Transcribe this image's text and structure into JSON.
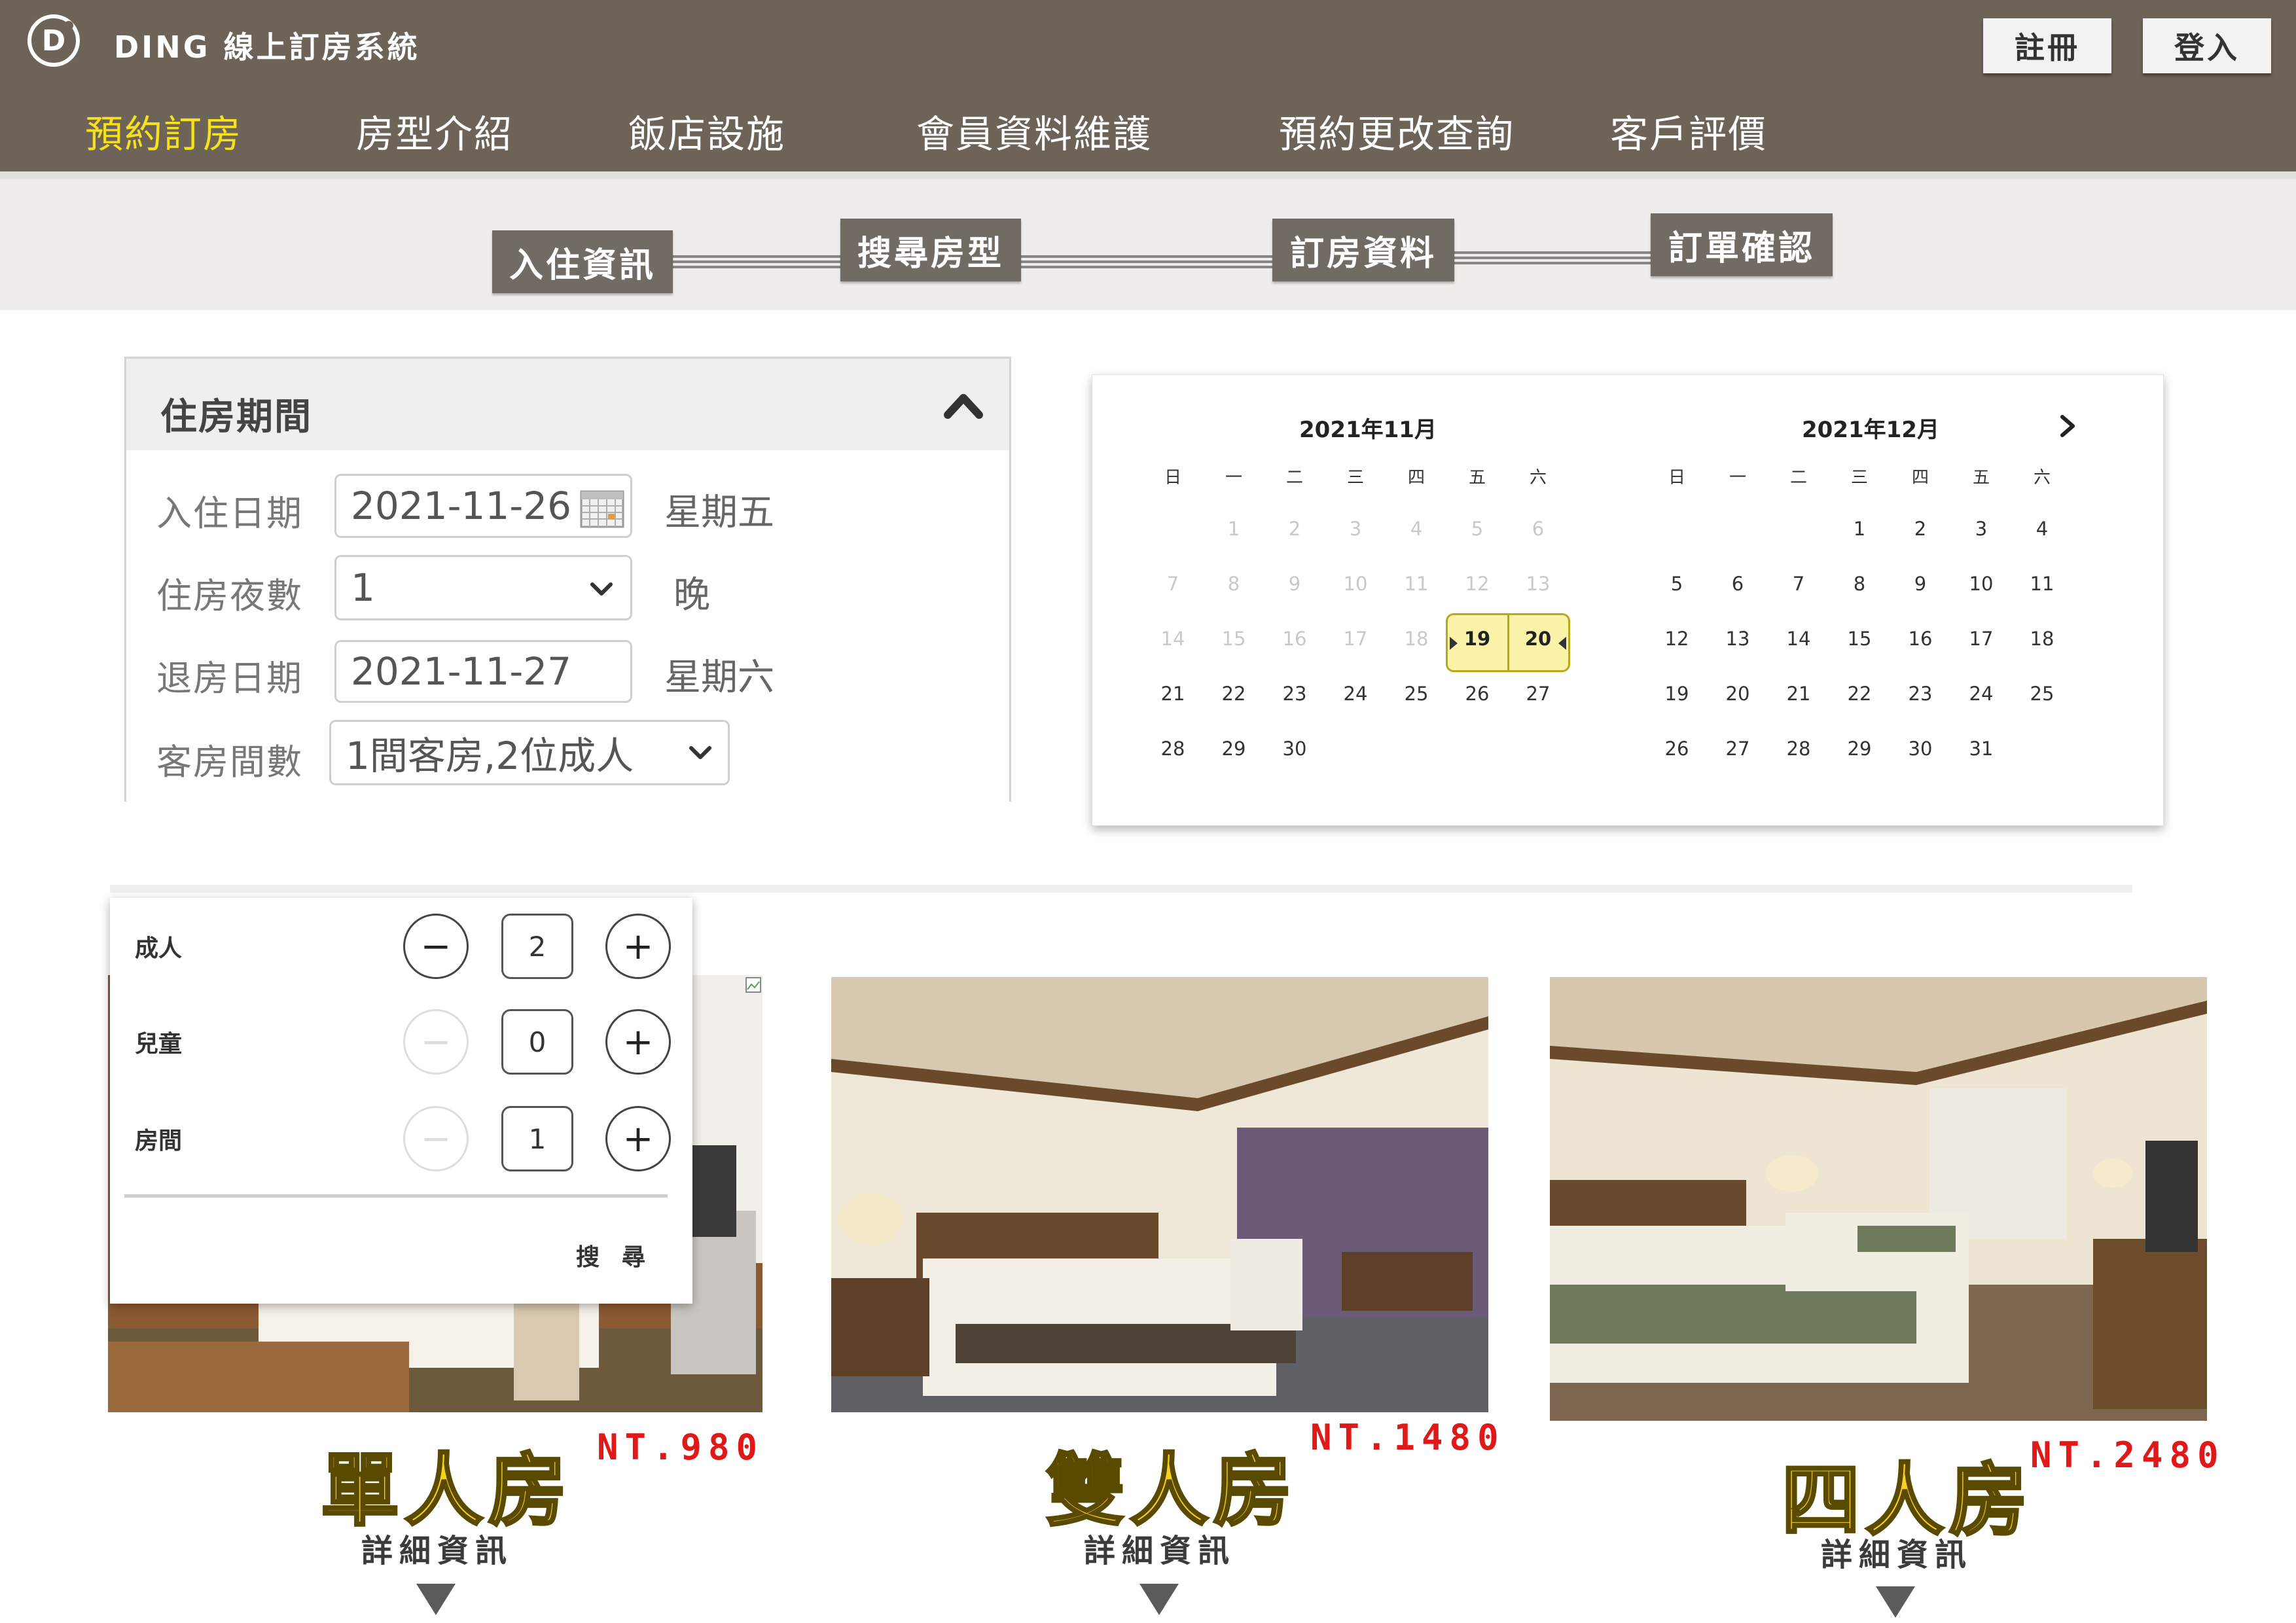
{
  "header": {
    "brand": "DING 線上訂房系統",
    "logo_letter": "D",
    "nav": [
      {
        "label": "預約訂房",
        "active": true
      },
      {
        "label": "房型介紹",
        "active": false
      },
      {
        "label": "飯店設施",
        "active": false
      },
      {
        "label": "會員資料維護",
        "active": false
      },
      {
        "label": "預約更改查詢",
        "active": false
      },
      {
        "label": "客戶評價",
        "active": false
      }
    ],
    "register_label": "註冊",
    "login_label": "登入",
    "active_color": "#f6e21a",
    "bg_color": "#6e6358"
  },
  "steps": [
    "入住資訊",
    "搜尋房型",
    "訂房資料",
    "訂單確認"
  ],
  "stay": {
    "title": "住房期間",
    "checkin_label": "入住日期",
    "checkin_value": "2021-11-26",
    "checkin_weekday": "星期五",
    "nights_label": "住房夜數",
    "nights_value": "1",
    "nights_unit": "晚",
    "checkout_label": "退房日期",
    "checkout_value": "2021-11-27",
    "checkout_weekday": "星期六",
    "rooms_label": "客房間數",
    "rooms_value": "1間客房,2位成人"
  },
  "calendar": {
    "weekdays": [
      "日",
      "一",
      "二",
      "三",
      "四",
      "五",
      "六"
    ],
    "months": [
      {
        "title": "2021年11月",
        "weeks": [
          [
            "",
            "1",
            "2",
            "3",
            "4",
            "5",
            "6"
          ],
          [
            "7",
            "8",
            "9",
            "10",
            "11",
            "12",
            "13"
          ],
          [
            "14",
            "15",
            "16",
            "17",
            "18",
            "19",
            "20"
          ],
          [
            "21",
            "22",
            "23",
            "24",
            "25",
            "26",
            "27"
          ],
          [
            "28",
            "29",
            "30",
            "",
            "",
            "",
            ""
          ]
        ],
        "dim_before": 20
      },
      {
        "title": "2021年12月",
        "weeks": [
          [
            "",
            "",
            "",
            "1",
            "2",
            "3",
            "4"
          ],
          [
            "5",
            "6",
            "7",
            "8",
            "9",
            "10",
            "11"
          ],
          [
            "12",
            "13",
            "14",
            "15",
            "16",
            "17",
            "18"
          ],
          [
            "19",
            "20",
            "21",
            "22",
            "23",
            "24",
            "25"
          ],
          [
            "26",
            "27",
            "28",
            "29",
            "30",
            "31",
            ""
          ]
        ],
        "dim_before": 0
      }
    ],
    "selected": [
      "19",
      "20"
    ],
    "next_icon": "chevron-right-icon"
  },
  "guests": {
    "rows": [
      {
        "label": "成人",
        "value": "2",
        "minus_enabled": true
      },
      {
        "label": "兒童",
        "value": "0",
        "minus_enabled": false
      },
      {
        "label": "房間",
        "value": "1",
        "minus_enabled": false
      }
    ],
    "search_label": "搜尋"
  },
  "rooms": [
    {
      "name": "單人房",
      "price": "NT.980",
      "detail": "詳細資訊"
    },
    {
      "name": "雙人房",
      "price": "NT.1480",
      "detail": "詳細資訊"
    },
    {
      "name": "四人房",
      "price": "NT.2480",
      "detail": "詳細資訊"
    }
  ]
}
